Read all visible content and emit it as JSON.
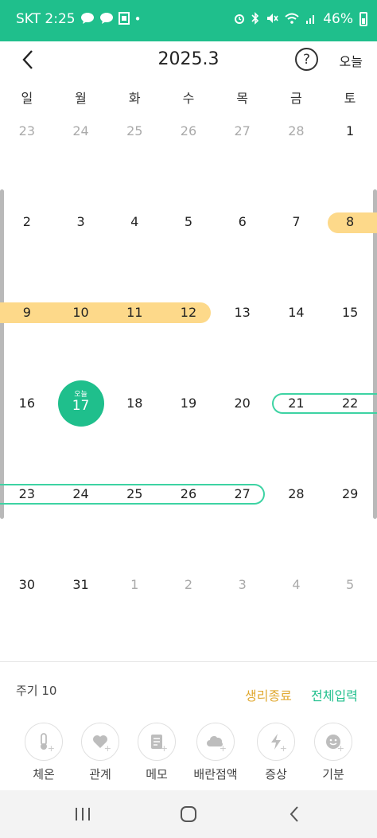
{
  "status_bar": {
    "carrier_time": "SKT 2:25",
    "battery": "46%",
    "background_color": "#1fbf8c",
    "left_icons": [
      "talk-bubble-icon",
      "talk-bubble-icon",
      "sim-icon",
      "dot-icon"
    ],
    "right_icons": [
      "alarm-icon",
      "bluetooth-icon",
      "mute-icon",
      "wifi-icon",
      "signal-icon",
      "battery-icon"
    ]
  },
  "header": {
    "title": "2025.3",
    "help_label": "?",
    "today_label": "오늘"
  },
  "weekdays": [
    "일",
    "월",
    "화",
    "수",
    "목",
    "금",
    "토"
  ],
  "calendar": {
    "weeks": [
      [
        {
          "d": "23",
          "o": true
        },
        {
          "d": "24",
          "o": true
        },
        {
          "d": "25",
          "o": true
        },
        {
          "d": "26",
          "o": true
        },
        {
          "d": "27",
          "o": true
        },
        {
          "d": "28",
          "o": true
        },
        {
          "d": "1",
          "o": false
        }
      ],
      [
        {
          "d": "2",
          "o": false
        },
        {
          "d": "3",
          "o": false
        },
        {
          "d": "4",
          "o": false
        },
        {
          "d": "5",
          "o": false
        },
        {
          "d": "6",
          "o": false
        },
        {
          "d": "7",
          "o": false
        },
        {
          "d": "8",
          "o": false
        }
      ],
      [
        {
          "d": "9",
          "o": false
        },
        {
          "d": "10",
          "o": false
        },
        {
          "d": "11",
          "o": false
        },
        {
          "d": "12",
          "o": false
        },
        {
          "d": "13",
          "o": false
        },
        {
          "d": "14",
          "o": false
        },
        {
          "d": "15",
          "o": false
        }
      ],
      [
        {
          "d": "16",
          "o": false
        },
        {
          "d": "17",
          "o": false
        },
        {
          "d": "18",
          "o": false
        },
        {
          "d": "19",
          "o": false
        },
        {
          "d": "20",
          "o": false
        },
        {
          "d": "21",
          "o": false
        },
        {
          "d": "22",
          "o": false
        }
      ],
      [
        {
          "d": "23",
          "o": false
        },
        {
          "d": "24",
          "o": false
        },
        {
          "d": "25",
          "o": false
        },
        {
          "d": "26",
          "o": false
        },
        {
          "d": "27",
          "o": false
        },
        {
          "d": "28",
          "o": false
        },
        {
          "d": "29",
          "o": false
        }
      ],
      [
        {
          "d": "30",
          "o": false
        },
        {
          "d": "31",
          "o": false
        },
        {
          "d": "1",
          "o": true
        },
        {
          "d": "2",
          "o": true
        },
        {
          "d": "3",
          "o": true
        },
        {
          "d": "4",
          "o": true
        },
        {
          "d": "5",
          "o": true
        }
      ]
    ],
    "today": {
      "label": "오늘",
      "day": "17"
    },
    "period_color": "#fdd98a",
    "predicted_color": "#3dd3a3",
    "today_color": "#1fbf8c"
  },
  "bottom": {
    "cycle_label": "주기 10",
    "end_period_label": "생리종료",
    "full_input_label": "전체입력",
    "end_period_color": "#e0a932",
    "full_input_color": "#1fbf8c",
    "quick_actions": [
      {
        "label": "체온",
        "icon": "thermometer-icon"
      },
      {
        "label": "관계",
        "icon": "heart-icon"
      },
      {
        "label": "메모",
        "icon": "memo-icon"
      },
      {
        "label": "배란점액",
        "icon": "mucus-icon"
      },
      {
        "label": "증상",
        "icon": "lightning-icon"
      },
      {
        "label": "기분",
        "icon": "mood-face-icon"
      }
    ]
  },
  "nav_bar": {
    "icons": [
      "recent-apps-icon",
      "home-icon",
      "back-icon"
    ]
  }
}
